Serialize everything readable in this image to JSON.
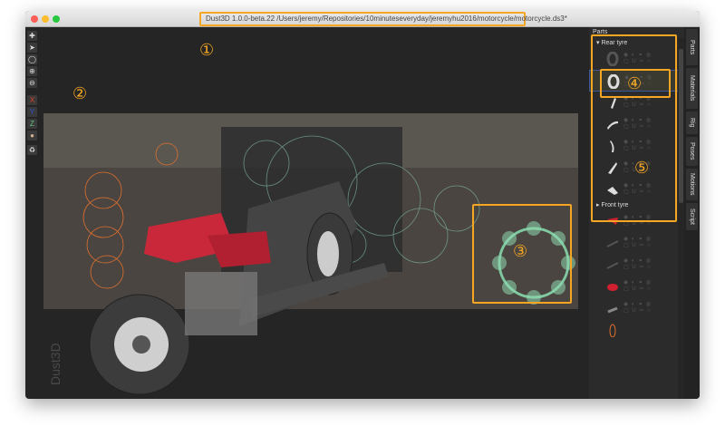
{
  "window": {
    "title": "Dust3D 1.0.0-beta.22 /Users/jeremy/Repositories/10minuteseveryday/jeremyhu2016/motorcycle/motorcycle.ds3*"
  },
  "toolbar": {
    "tools": [
      {
        "icon": "add-icon",
        "glyph": "✚"
      },
      {
        "icon": "pointer-icon",
        "glyph": "➤"
      },
      {
        "icon": "lasso-icon",
        "glyph": "◯"
      },
      {
        "icon": "zoom-in-icon",
        "glyph": "⊕"
      },
      {
        "icon": "zoom-out-icon",
        "glyph": "⊖"
      },
      {
        "icon": "x-mirror",
        "glyph": "X"
      },
      {
        "icon": "y-mirror",
        "glyph": "Y"
      },
      {
        "icon": "z-mirror",
        "glyph": "Z"
      },
      {
        "icon": "radius-icon",
        "glyph": "●"
      },
      {
        "icon": "regenerate-icon",
        "glyph": "♻"
      }
    ]
  },
  "canvas": {
    "watermark": "Dust3D"
  },
  "parts": {
    "title": "Parts",
    "rear_group": "Rear tyre",
    "front_group": "Front tyre",
    "controls": "◉ ◐ ⚭ ◍\n▢ U ✂ ○"
  },
  "tabs": [
    "Parts",
    "Materials",
    "Rig",
    "Poses",
    "Motions",
    "Script"
  ],
  "annotations": [
    "①",
    "②",
    "③",
    "④",
    "⑤"
  ],
  "colors": {
    "accent": "#f5a623",
    "selected": "#3a5a9a"
  }
}
